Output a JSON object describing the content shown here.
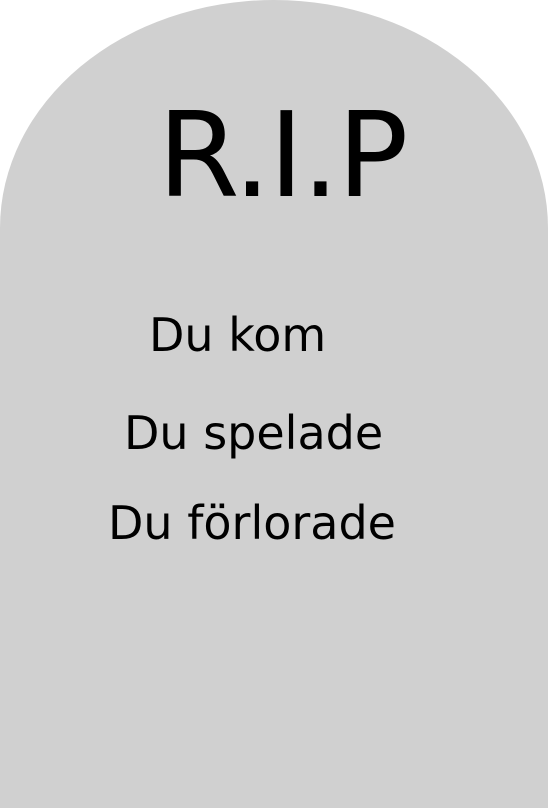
{
  "tombstone": {
    "color": "#d0d0d0",
    "title": "R.I.P",
    "lines": [
      "Du kom",
      "Du spelade",
      "Du förlorade"
    ]
  }
}
